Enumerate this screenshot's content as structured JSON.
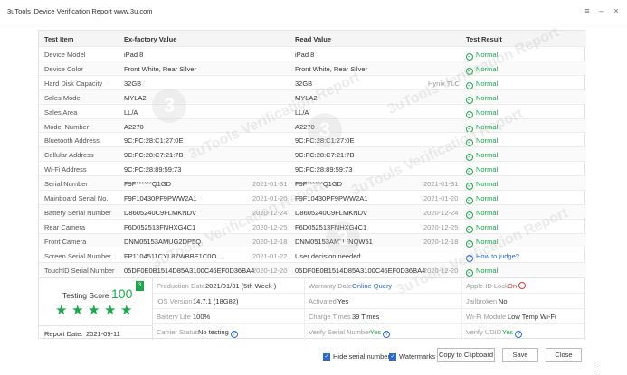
{
  "window": {
    "title": "3uTools iDevice Verification Report www.3u.com",
    "controls": [
      "≡",
      "–",
      "×"
    ]
  },
  "table": {
    "headers": [
      "Test Item",
      "Ex-factory Value",
      "Read Value",
      "Test Result"
    ],
    "rows": [
      {
        "item": "Device Model",
        "factory": "iPad 8",
        "factory_date": "",
        "read": "iPad 8",
        "read_date": "",
        "hint": "",
        "result": "Normal",
        "result_type": "ok"
      },
      {
        "item": "Device Color",
        "factory": "Front White, Rear Silver",
        "factory_date": "",
        "read": "Front White, Rear Silver",
        "read_date": "",
        "hint": "",
        "result": "Normal",
        "result_type": "ok"
      },
      {
        "item": "Hard Disk Capacity",
        "factory": "32GB",
        "factory_date": "",
        "read": "32GB",
        "read_date": "",
        "hint": "Hynix TLC",
        "result": "Normal",
        "result_type": "ok"
      },
      {
        "item": "Sales Model",
        "factory": "MYLA2",
        "factory_date": "",
        "read": "MYLA2",
        "read_date": "",
        "hint": "",
        "result": "Normal",
        "result_type": "ok"
      },
      {
        "item": "Sales Area",
        "factory": "LL/A",
        "factory_date": "",
        "read": "LL/A",
        "read_date": "",
        "hint": "",
        "result": "Normal",
        "result_type": "ok"
      },
      {
        "item": "Model Number",
        "factory": "A2270",
        "factory_date": "",
        "read": "A2270",
        "read_date": "",
        "hint": "",
        "result": "Normal",
        "result_type": "ok"
      },
      {
        "item": "Bluetooth Address",
        "factory": "9C:FC:28:C1:27:0E",
        "factory_date": "",
        "read": "9C:FC:28:C1:27:0E",
        "read_date": "",
        "hint": "",
        "result": "Normal",
        "result_type": "ok"
      },
      {
        "item": "Cellular Address",
        "factory": "9C:FC:28:C7:21:7B",
        "factory_date": "",
        "read": "9C:FC:28:C7:21:7B",
        "read_date": "",
        "hint": "",
        "result": "Normal",
        "result_type": "ok"
      },
      {
        "item": "Wi-Fi Address",
        "factory": "9C:FC:28:89:59:73",
        "factory_date": "",
        "read": "9C:FC:28:89:59:73",
        "read_date": "",
        "hint": "",
        "result": "Normal",
        "result_type": "ok"
      },
      {
        "item": "Serial Number",
        "factory": "F9F******Q1GD",
        "factory_date": "2021-01-31",
        "read": "F9F******Q1GD",
        "read_date": "2021-01-31",
        "hint": "",
        "result": "Normal",
        "result_type": "ok"
      },
      {
        "item": "Mainboard Serial No.",
        "factory": "F9F10430PF9PWW2A1",
        "factory_date": "2021-01-20",
        "read": "F9F10430PF9PWW2A1",
        "read_date": "2021-01-20",
        "hint": "",
        "result": "Normal",
        "result_type": "ok"
      },
      {
        "item": "Battery Serial Number",
        "factory": "D8605240C9FLMKNDV",
        "factory_date": "2020-12-24",
        "read": "D8605240C9FLMKNDV",
        "read_date": "2020-12-24",
        "hint": "",
        "result": "Normal",
        "result_type": "ok"
      },
      {
        "item": "Rear Camera",
        "factory": "F6D052513FNHXG4C1",
        "factory_date": "2020-12-25",
        "read": "F6D052513FNHXG4C1",
        "read_date": "2020-12-25",
        "hint": "",
        "result": "Normal",
        "result_type": "ok"
      },
      {
        "item": "Front Camera",
        "factory": "DNM05153AMUG2DP5Q",
        "factory_date": "2020-12-18",
        "read": "DNM05153AMUFNQW51",
        "read_date": "2020-12-18",
        "hint": "",
        "result": "Normal",
        "result_type": "ok"
      },
      {
        "item": "Screen Serial Number",
        "factory": "FP1104511CYL87WBBE1C0O...",
        "factory_date": "2021-01-22",
        "read": "User decision needed",
        "read_date": "",
        "hint": "",
        "result": "How to judge?",
        "result_type": "question"
      },
      {
        "item": "TouchID Serial Number",
        "factory": "05DF0E0B1514D85A3100C46EF0D36BA4",
        "factory_date": "2020-12-20",
        "read": "05DF0E0B1514D85A3100C46EF0D36BA4",
        "read_date": "2020-12-20",
        "hint": "",
        "result": "Normal",
        "result_type": "ok"
      }
    ]
  },
  "score": {
    "label": "Testing Score",
    "value": "100",
    "badge": "3",
    "stars": 5,
    "report_date_label": "Report Date:",
    "report_date": "2021-09-11"
  },
  "summary": {
    "production_date_label": "Production Date",
    "production_date": "2021/01/31 (5th Week )",
    "warranty_label": "Warranty Date",
    "warranty_link": "Online Query",
    "apple_id_label": "Apple ID Lock",
    "apple_id_value": "On",
    "ios_label": "iOS Version",
    "ios_value": "14.7.1 (18G82)",
    "activated_label": "Activated",
    "activated_value": "Yes",
    "jailbroken_label": "Jailbroken",
    "jailbroken_value": "No",
    "battery_label": "Battery Life",
    "battery_value": "100%",
    "charge_label": "Charge Times",
    "charge_value": "39 Times",
    "wifi_label": "Wi-Fi Module",
    "wifi_value": "Low Temp Wi-Fi",
    "carrier_label": "Carrier Status",
    "carrier_value": "No testing",
    "verify_serial_label": "Verify Serial Number",
    "verify_serial_value": "Yes",
    "verify_udid_label": "Verify UDID",
    "verify_udid_value": "Yes"
  },
  "footer": {
    "hide_serial_label": "Hide serial number",
    "watermarks_label": "Watermarks",
    "copy_button": "Copy to Clipboard",
    "save_button": "Save",
    "close_button": "Close"
  },
  "watermark": {
    "text": "3uTools Verification Report",
    "sub": "www.3u.com",
    "logo": "3"
  }
}
